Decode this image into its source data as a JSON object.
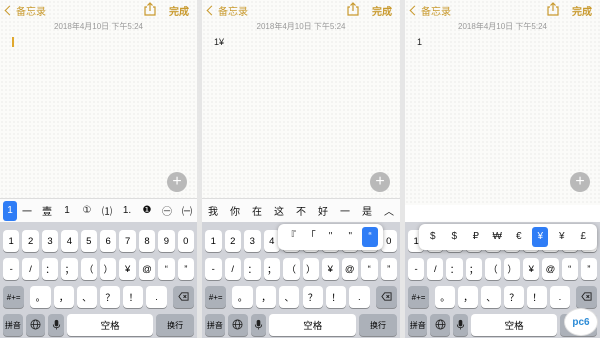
{
  "nav": {
    "back_label": "备忘录",
    "done_label": "完成"
  },
  "note": {
    "date": "2018年4月10日 下午5:24"
  },
  "panels": [
    {
      "note_text": "",
      "candidates": [
        "1",
        "一",
        "壹",
        "1",
        "①",
        "⑴",
        "1.",
        "❶",
        "㊀",
        "㈠"
      ]
    },
    {
      "note_text": "1¥",
      "candidates": [
        "我",
        "你",
        "在",
        "这",
        "不",
        "好",
        "一",
        "是"
      ],
      "expand_icon": "chevron-up-icon",
      "popup_keys": [
        "『",
        "「",
        "\"",
        "\"",
        "“"
      ]
    },
    {
      "note_text": "1",
      "popup_keys": [
        "$",
        "$",
        "₽",
        "₩",
        "€",
        "¥",
        "¥",
        "£"
      ]
    }
  ],
  "keyboard": {
    "row1": [
      "1",
      "2",
      "3",
      "4",
      "5",
      "6",
      "7",
      "8",
      "9",
      "0"
    ],
    "row2": [
      "-",
      "/",
      "：",
      "；",
      "（",
      "）",
      "¥",
      "@",
      "“",
      "”"
    ],
    "row3": [
      "#+=",
      "。",
      "，",
      "、",
      "？",
      "！",
      "."
    ],
    "row4": {
      "mode": "拼音",
      "space": "空格",
      "return": "换行"
    }
  },
  "watermark": "pc6",
  "colors": {
    "accent": "#c99a2e",
    "selection": "#2f7df6",
    "keyboard_bg": "#d1d3d9"
  }
}
